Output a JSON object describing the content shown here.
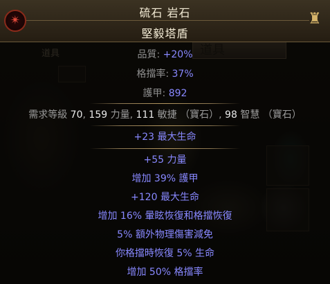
{
  "item": {
    "name": "硫石 岩石",
    "base": "堅毅塔盾"
  },
  "backdrop": {
    "stash_tab_label": "道具",
    "stash_tab_label_left": "道具"
  },
  "properties": [
    {
      "label": "品質: ",
      "value": "+20%"
    },
    {
      "label": "格擋率: ",
      "value": "37%"
    },
    {
      "label": "護甲: ",
      "value": "892"
    }
  ],
  "requirements": {
    "prefix": "需求等級 ",
    "level": "70",
    "sep1": ", ",
    "str": "159",
    "str_label": " 力量, ",
    "dex": "111",
    "dex_label": " 敏捷 （寶石）, ",
    "int": "98",
    "int_label": " 智慧 （寶石）"
  },
  "implicit": [
    "+23 最大生命"
  ],
  "explicit": [
    "+55 力量",
    "增加 39% 護甲",
    "+120 最大生命",
    "增加 16% 暈眩恢復和格擋恢復",
    "5% 額外物理傷害減免",
    "你格擋時恢復 5% 生命",
    "增加 50% 格擋率"
  ],
  "icons": {
    "left_influence": "shaper-icon",
    "right_influence": "warlord-icon"
  },
  "colors": {
    "magic_blue": "#8888ff",
    "label_grey": "#8f8f8f",
    "header_text": "#f4ecd6"
  }
}
